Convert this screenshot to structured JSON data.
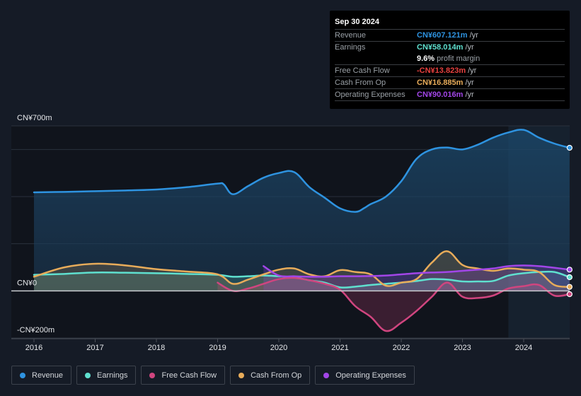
{
  "tooltip": {
    "date": "Sep 30 2024",
    "rows": [
      {
        "label": "Revenue",
        "value": "CN¥607.121m",
        "unit": "/yr",
        "color": "#2e93e0"
      },
      {
        "label": "Earnings",
        "value": "CN¥58.014m",
        "unit": "/yr",
        "color": "#5fe0cf"
      },
      {
        "label": "",
        "value": "9.6%",
        "unit": "profit margin",
        "color": "#ffffff"
      },
      {
        "label": "Free Cash Flow",
        "value": "-CN¥13.823m",
        "unit": "/yr",
        "color": "#e8413f"
      },
      {
        "label": "Cash From Op",
        "value": "CN¥16.885m",
        "unit": "/yr",
        "color": "#e8ac5a"
      },
      {
        "label": "Operating Expenses",
        "value": "CN¥90.016m",
        "unit": "/yr",
        "color": "#a246e8"
      }
    ]
  },
  "legend": [
    {
      "label": "Revenue",
      "color": "#2e93e0"
    },
    {
      "label": "Earnings",
      "color": "#5fe0cf"
    },
    {
      "label": "Free Cash Flow",
      "color": "#d0457f"
    },
    {
      "label": "Cash From Op",
      "color": "#e8ac5a"
    },
    {
      "label": "Operating Expenses",
      "color": "#a246e8"
    }
  ],
  "chart_data": {
    "type": "line",
    "title": "",
    "xlabel": "",
    "ylabel": "",
    "ylim": [
      -200,
      700
    ],
    "xlim": [
      2015.6,
      2024.85
    ],
    "y_ticks": [
      {
        "value": 700,
        "label": "CN¥700m"
      },
      {
        "value": 0,
        "label": "CN¥0"
      },
      {
        "value": -200,
        "label": "-CN¥200m"
      }
    ],
    "x_ticks": [
      "2016",
      "2017",
      "2018",
      "2019",
      "2020",
      "2021",
      "2022",
      "2023",
      "2024"
    ],
    "highlight_range": [
      2023.75,
      2024.75
    ],
    "series": [
      {
        "name": "Revenue",
        "color": "#2e93e0",
        "x": [
          2016.0,
          2016.5,
          2017.0,
          2017.5,
          2018.0,
          2018.5,
          2019.0,
          2019.1,
          2019.25,
          2019.5,
          2019.75,
          2020.0,
          2020.25,
          2020.5,
          2020.75,
          2021.0,
          2021.25,
          2021.4,
          2021.5,
          2021.75,
          2022.0,
          2022.25,
          2022.5,
          2022.75,
          2023.0,
          2023.25,
          2023.5,
          2023.75,
          2024.0,
          2024.25,
          2024.5,
          2024.75
        ],
        "values": [
          418,
          420,
          423,
          426,
          430,
          440,
          455,
          452,
          410,
          445,
          480,
          500,
          504,
          440,
          395,
          350,
          335,
          352,
          368,
          400,
          465,
          560,
          600,
          608,
          600,
          620,
          650,
          672,
          683,
          650,
          625,
          607
        ]
      },
      {
        "name": "Earnings",
        "color": "#5fe0cf",
        "x": [
          2016.0,
          2016.5,
          2017.0,
          2017.5,
          2018.0,
          2018.5,
          2019.0,
          2019.25,
          2019.5,
          2019.75,
          2020.0,
          2020.25,
          2020.5,
          2020.75,
          2021.0,
          2021.25,
          2021.5,
          2021.75,
          2022.0,
          2022.25,
          2022.5,
          2022.75,
          2023.0,
          2023.25,
          2023.5,
          2023.75,
          2024.0,
          2024.25,
          2024.5,
          2024.75
        ],
        "values": [
          68,
          72,
          78,
          77,
          75,
          72,
          68,
          60,
          62,
          65,
          62,
          58,
          45,
          35,
          15,
          18,
          25,
          30,
          35,
          42,
          50,
          48,
          40,
          40,
          42,
          65,
          75,
          80,
          80,
          58
        ]
      },
      {
        "name": "Free Cash Flow",
        "color": "#d0457f",
        "x": [
          2019.0,
          2019.25,
          2019.5,
          2019.75,
          2020.0,
          2020.25,
          2020.5,
          2020.75,
          2021.0,
          2021.25,
          2021.5,
          2021.75,
          2022.0,
          2022.25,
          2022.5,
          2022.75,
          2023.0,
          2023.25,
          2023.5,
          2023.75,
          2024.0,
          2024.25,
          2024.5,
          2024.75
        ],
        "values": [
          35,
          0,
          10,
          30,
          50,
          55,
          45,
          30,
          5,
          -65,
          -110,
          -170,
          -135,
          -85,
          -25,
          35,
          -25,
          -30,
          -20,
          10,
          20,
          25,
          -20,
          -14
        ]
      },
      {
        "name": "Cash From Op",
        "color": "#e8ac5a",
        "x": [
          2016.0,
          2016.5,
          2017.0,
          2017.5,
          2018.0,
          2018.5,
          2019.0,
          2019.25,
          2019.5,
          2019.75,
          2020.0,
          2020.25,
          2020.5,
          2020.75,
          2021.0,
          2021.25,
          2021.5,
          2021.75,
          2022.0,
          2022.25,
          2022.5,
          2022.75,
          2023.0,
          2023.25,
          2023.5,
          2023.75,
          2024.0,
          2024.25,
          2024.5,
          2024.75
        ],
        "values": [
          60,
          100,
          115,
          108,
          92,
          82,
          70,
          30,
          48,
          70,
          90,
          95,
          70,
          62,
          88,
          80,
          70,
          22,
          35,
          50,
          120,
          168,
          110,
          95,
          85,
          95,
          90,
          80,
          25,
          17
        ]
      },
      {
        "name": "Operating Expenses",
        "color": "#a246e8",
        "x": [
          2019.75,
          2020.0,
          2020.25,
          2020.5,
          2020.75,
          2021.0,
          2021.25,
          2021.5,
          2021.75,
          2022.0,
          2022.25,
          2022.5,
          2022.75,
          2023.0,
          2023.25,
          2023.5,
          2023.75,
          2024.0,
          2024.25,
          2024.5,
          2024.75
        ],
        "values": [
          105,
          65,
          62,
          60,
          60,
          62,
          62,
          63,
          65,
          70,
          75,
          78,
          80,
          85,
          90,
          95,
          105,
          108,
          105,
          98,
          90
        ]
      }
    ]
  }
}
